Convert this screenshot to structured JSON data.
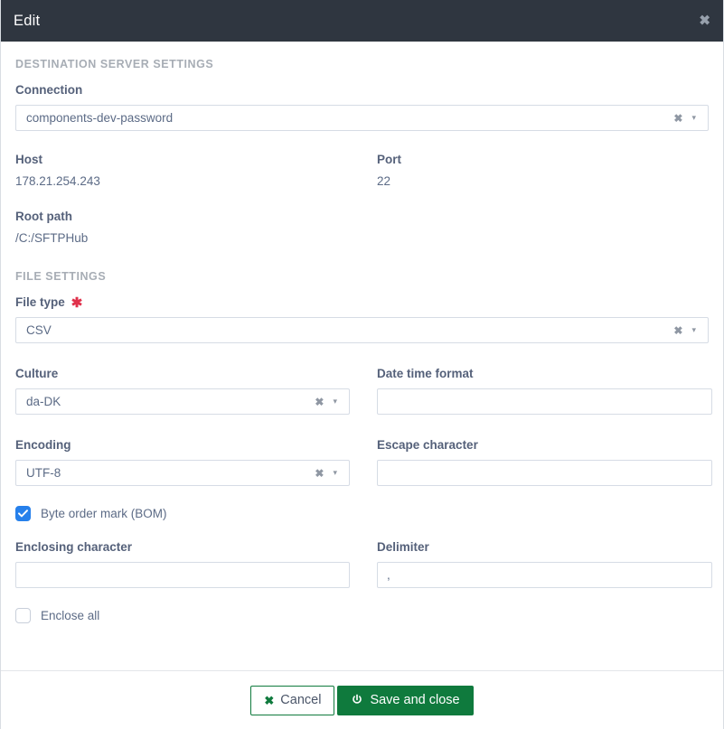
{
  "header": {
    "title": "Edit",
    "close_label": "✖"
  },
  "sections": {
    "destination": {
      "title": "DESTINATION SERVER SETTINGS",
      "connection": {
        "label": "Connection",
        "value": "components-dev-password",
        "clear_icon": "✖",
        "arrow_icon": "▾"
      },
      "host": {
        "label": "Host",
        "value": "178.21.254.243"
      },
      "port": {
        "label": "Port",
        "value": "22"
      },
      "root_path": {
        "label": "Root path",
        "value": "/C:/SFTPHub"
      }
    },
    "file_settings": {
      "title": "FILE SETTINGS",
      "file_type": {
        "label": "File type",
        "required_mark": "✱",
        "value": "CSV",
        "clear_icon": "✖",
        "arrow_icon": "▾"
      },
      "culture": {
        "label": "Culture",
        "value": "da-DK",
        "clear_icon": "✖",
        "arrow_icon": "▾"
      },
      "date_time_format": {
        "label": "Date time format",
        "value": "",
        "placeholder": ""
      },
      "encoding": {
        "label": "Encoding",
        "value": "UTF-8",
        "clear_icon": "✖",
        "arrow_icon": "▾"
      },
      "escape_character": {
        "label": "Escape character",
        "value": "",
        "placeholder": ""
      },
      "byte_order_mark": {
        "label": "Byte order mark (BOM)",
        "checked": true
      },
      "enclosing_character": {
        "label": "Enclosing character",
        "value": "",
        "placeholder": ""
      },
      "delimiter": {
        "label": "Delimiter",
        "value": ",",
        "placeholder": ""
      },
      "enclose_all": {
        "label": "Enclose all",
        "checked": false
      }
    }
  },
  "footer": {
    "cancel_label": "Cancel",
    "cancel_icon": "✖",
    "save_label": "Save and close"
  },
  "colors": {
    "header_bg": "#2f3640",
    "accent_green": "#0f7a3d",
    "checkbox_blue": "#2680eb",
    "required_red": "#e0314b",
    "label_text": "#55617a",
    "section_text": "#a7adb5"
  }
}
